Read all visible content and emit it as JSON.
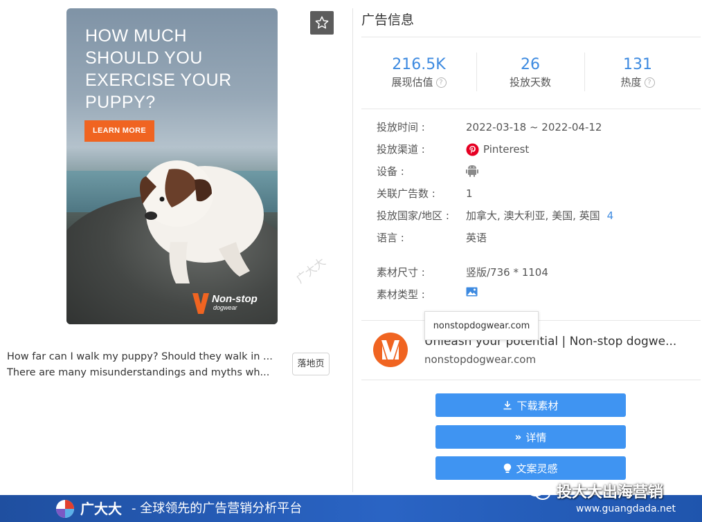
{
  "ad": {
    "headline": "HOW MUCH SHOULD YOU EXERCISE YOUR PUPPY?",
    "cta_label": "LEARN MORE",
    "brand_name": "Non-stop",
    "brand_sub": "dogwear",
    "description_line1": "How far can I walk my puppy? Should they walk in ...",
    "description_line2": "There are many misunderstandings and myths wh...",
    "landing_button": "落地页",
    "watermark": "广大大"
  },
  "panel": {
    "title": "广告信息",
    "stats": [
      {
        "value": "216.5K",
        "label": "展现估值"
      },
      {
        "value": "26",
        "label": "投放天数"
      },
      {
        "value": "131",
        "label": "热度"
      }
    ],
    "details": {
      "period_label": "投放时间 :",
      "period_value": "2022-03-18 ~ 2022-04-12",
      "channel_label": "投放渠道 :",
      "channel_value": "Pinterest",
      "device_label": "设备 :",
      "related_label": "关联广告数 :",
      "related_value": "1",
      "countries_label": "投放国家/地区 :",
      "countries_value": "加拿大, 澳大利亚, 美国, 英国",
      "countries_more": "4",
      "language_label": "语言 :",
      "language_value": "英语",
      "size_label": "素材尺寸 :",
      "size_value": "竖版/736 * 1104",
      "type_label": "素材类型 :"
    },
    "tooltip": "nonstopdogwear.com",
    "landing": {
      "title": "Unleash your potential | Non-stop dogwe...",
      "domain": "nonstopdogwear.com"
    },
    "actions": {
      "download": "下载素材",
      "details": "详情",
      "copy_idea": "文案灵感"
    }
  },
  "footer": {
    "brand": "广大大",
    "slogan": "- 全球领先的广告营销分析平台",
    "url": "www.guangdada.net",
    "wechat_account": "投大大出海营销"
  },
  "colors": {
    "accent": "#3d8ae0",
    "button": "#3f94f2",
    "cta": "#f06421",
    "pinterest": "#e60023",
    "footer": "#2a64c4"
  }
}
